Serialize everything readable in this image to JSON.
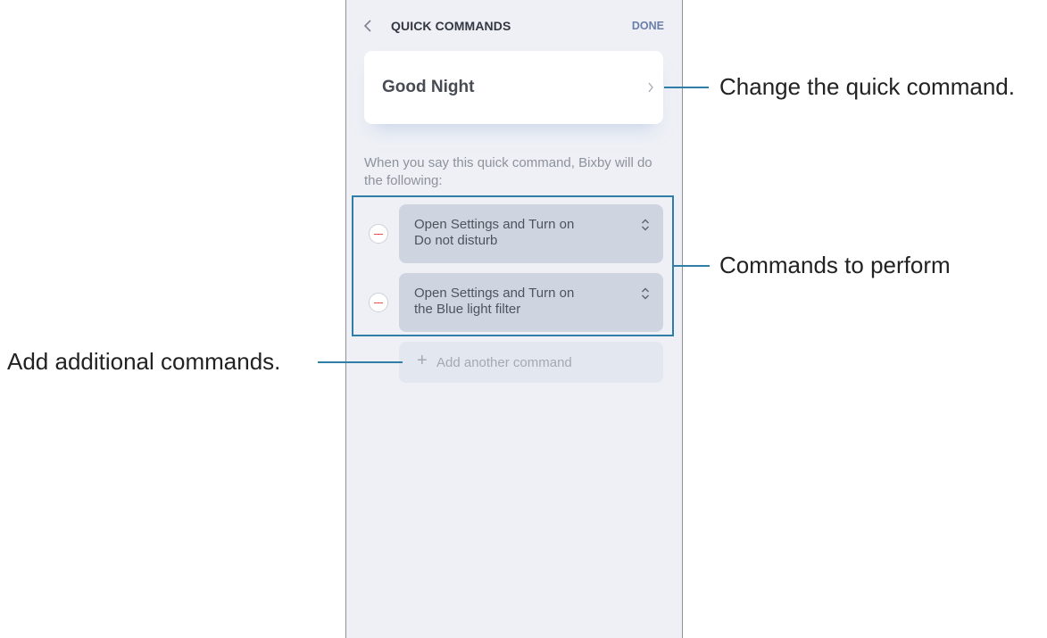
{
  "app": {
    "title": "QUICK COMMANDS",
    "done_label": "DONE",
    "command_name": "Good Night",
    "description": "When you say this quick command, Bixby will do the following:",
    "actions": [
      {
        "line1": "Open Settings and Turn on",
        "line2": "Do not disturb"
      },
      {
        "line1": "Open Settings and Turn on",
        "line2": "the Blue light filter"
      }
    ],
    "add_plus": "+",
    "add_label": "Add another command"
  },
  "callouts": {
    "change": "Change the quick command.",
    "commands": "Commands to perform",
    "add": "Add additional commands."
  },
  "icons": {
    "back": "chevron-left-icon",
    "card": "chevron-right-icon",
    "remove": "minus-circle-icon",
    "reorder": "up-down-arrows-icon"
  },
  "colors": {
    "callout": "#2f7ea8",
    "background": "#eef0f6",
    "action_box": "#cfd4e1",
    "remove_minus": "#e2504b",
    "done": "#6b7fa8"
  }
}
